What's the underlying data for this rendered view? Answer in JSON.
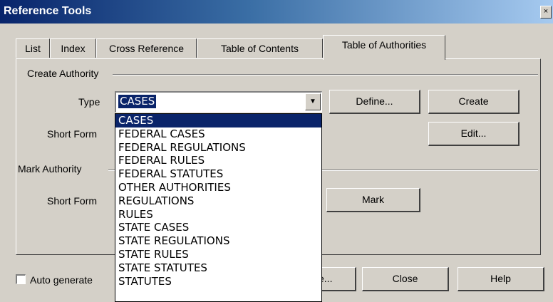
{
  "window": {
    "title": "Reference Tools",
    "close_glyph": "×"
  },
  "tabs": [
    {
      "label": "List"
    },
    {
      "label": "Index"
    },
    {
      "label": "Cross Reference"
    },
    {
      "label": "Table of Contents"
    },
    {
      "label": "Table of Authorities",
      "active": true
    }
  ],
  "create_authority": {
    "group_label": "Create Authority",
    "type_label": "Type",
    "type_value": "CASES",
    "short_form_label": "Short Form",
    "define_button": "Define...",
    "create_button": "Create",
    "edit_button": "Edit..."
  },
  "type_dropdown": {
    "options": [
      "CASES",
      "FEDERAL CASES",
      "FEDERAL REGULATIONS",
      "FEDERAL RULES",
      "FEDERAL STATUTES",
      "OTHER AUTHORITIES",
      "REGULATIONS",
      "RULES",
      "STATE CASES",
      "STATE REGULATIONS",
      "STATE RULES",
      "STATE STATUTES",
      "STATUTES"
    ],
    "selected": "CASES"
  },
  "mark_authority": {
    "group_label": "Mark Authority",
    "short_form_label": "Short Form",
    "mark_button": "Mark"
  },
  "footer": {
    "auto_generate_label": "Auto generate",
    "generate_button_partial": "e...",
    "close_button": "Close",
    "help_button": "Help"
  },
  "icons": {
    "dropdown_arrow": "chevron-down-icon",
    "window_close": "close-icon"
  }
}
